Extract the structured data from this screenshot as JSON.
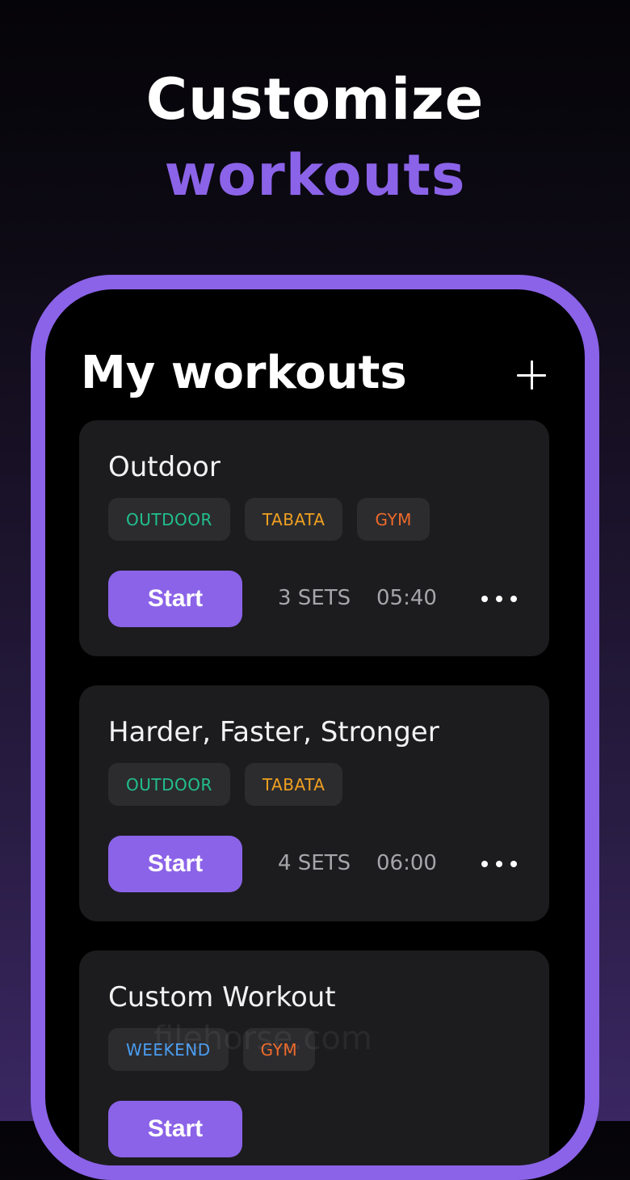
{
  "headline": {
    "line1": "Customize",
    "line2": "workouts"
  },
  "colors": {
    "accent": "#8b63e8",
    "outdoor": "#21c08b",
    "tabata": "#f0a020",
    "gym": "#ee6a2a",
    "weekend": "#4a9cf0"
  },
  "screen": {
    "title": "My workouts",
    "add_icon": "plus-icon"
  },
  "workouts": [
    {
      "title": "Outdoor",
      "tags": [
        {
          "label": "OUTDOOR",
          "color": "#21c08b"
        },
        {
          "label": "TABATA",
          "color": "#f0a020"
        },
        {
          "label": "GYM",
          "color": "#ee6a2a"
        }
      ],
      "start_label": "Start",
      "sets": "3 SETS",
      "duration": "05:40",
      "more_icon": "ellipsis-icon"
    },
    {
      "title": "Harder, Faster, Stronger",
      "tags": [
        {
          "label": "OUTDOOR",
          "color": "#21c08b"
        },
        {
          "label": "TABATA",
          "color": "#f0a020"
        }
      ],
      "start_label": "Start",
      "sets": "4 SETS",
      "duration": "06:00",
      "more_icon": "ellipsis-icon"
    },
    {
      "title": "Custom Workout",
      "tags": [
        {
          "label": "WEEKEND",
          "color": "#4a9cf0"
        },
        {
          "label": "GYM",
          "color": "#ee6a2a"
        }
      ],
      "start_label": "Start"
    }
  ],
  "watermark": "filehorse.com"
}
